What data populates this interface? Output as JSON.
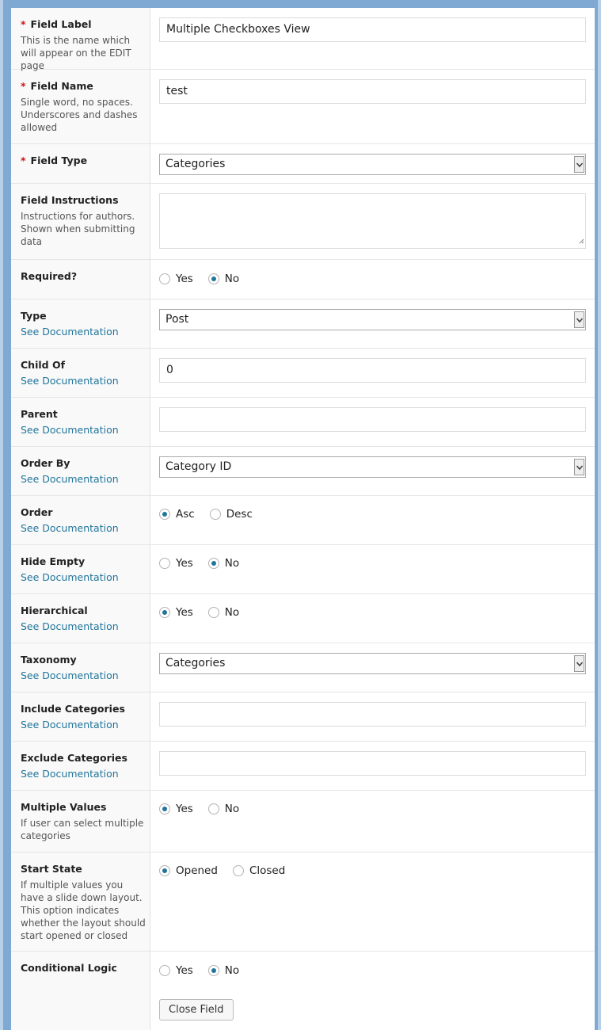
{
  "fields": [
    {
      "label": "Field Label",
      "required": true,
      "description": "This is the name which will appear on the EDIT page",
      "control": "text",
      "value": "Multiple Checkboxes View"
    },
    {
      "label": "Field Name",
      "required": true,
      "description": "Single word, no spaces. Underscores and dashes allowed",
      "control": "text",
      "value": "test"
    },
    {
      "label": "Field Type",
      "required": true,
      "control": "select",
      "value": "Categories"
    },
    {
      "label": "Field Instructions",
      "description": "Instructions for authors. Shown when submitting data",
      "control": "textarea",
      "value": ""
    },
    {
      "label": "Required?",
      "control": "radio",
      "options": [
        {
          "label": "Yes",
          "selected": false
        },
        {
          "label": "No",
          "selected": true
        }
      ]
    },
    {
      "label": "Type",
      "link": "See Documentation",
      "control": "select",
      "value": "Post"
    },
    {
      "label": "Child Of",
      "link": "See Documentation",
      "control": "text",
      "value": "0"
    },
    {
      "label": "Parent",
      "link": "See Documentation",
      "control": "text",
      "value": ""
    },
    {
      "label": "Order By",
      "link": "See Documentation",
      "control": "select",
      "value": "Category ID"
    },
    {
      "label": "Order",
      "link": "See Documentation",
      "control": "radio",
      "options": [
        {
          "label": "Asc",
          "selected": true
        },
        {
          "label": "Desc",
          "selected": false
        }
      ]
    },
    {
      "label": "Hide Empty",
      "link": "See Documentation",
      "control": "radio",
      "options": [
        {
          "label": "Yes",
          "selected": false
        },
        {
          "label": "No",
          "selected": true
        }
      ]
    },
    {
      "label": "Hierarchical",
      "link": "See Documentation",
      "control": "radio",
      "options": [
        {
          "label": "Yes",
          "selected": true
        },
        {
          "label": "No",
          "selected": false
        }
      ]
    },
    {
      "label": "Taxonomy",
      "link": "See Documentation",
      "control": "select",
      "value": "Categories"
    },
    {
      "label": "Include Categories",
      "link": "See Documentation",
      "control": "text",
      "value": ""
    },
    {
      "label": "Exclude Categories",
      "link": "See Documentation",
      "control": "text",
      "value": ""
    },
    {
      "label": "Multiple Values",
      "description": "If user can select multiple categories",
      "control": "radio",
      "options": [
        {
          "label": "Yes",
          "selected": true
        },
        {
          "label": "No",
          "selected": false
        }
      ]
    },
    {
      "label": "Start State",
      "description": "If multiple values you have a slide down layout. This option indicates whether the layout should start opened or closed",
      "control": "radio",
      "options": [
        {
          "label": "Opened",
          "selected": true
        },
        {
          "label": "Closed",
          "selected": false
        }
      ]
    },
    {
      "label": "Conditional Logic",
      "control": "radio",
      "options": [
        {
          "label": "Yes",
          "selected": false
        },
        {
          "label": "No",
          "selected": true
        }
      ]
    }
  ],
  "close_button": "Close Field",
  "colors": {
    "accent": "#21759b",
    "required": "#d21414",
    "frame": "#7fa8d3"
  }
}
